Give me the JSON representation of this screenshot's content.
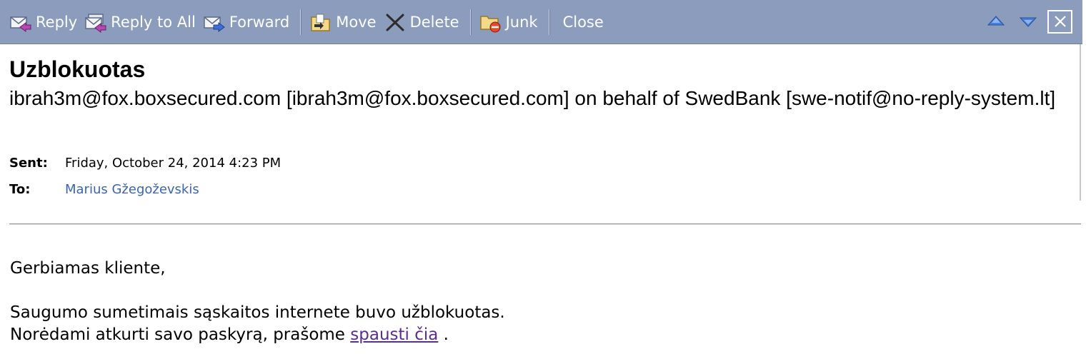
{
  "toolbar": {
    "reply_label": "Reply",
    "reply_all_label": "Reply to All",
    "forward_label": "Forward",
    "move_label": "Move",
    "delete_label": "Delete",
    "junk_label": "Junk",
    "close_label": "Close"
  },
  "message": {
    "subject": "Uzblokuotas",
    "from": "ibrah3m@fox.boxsecured.com [ibrah3m@fox.boxsecured.com] on behalf of SwedBank [swe-notif@no-reply-system.lt]",
    "sent_label": "Sent:",
    "sent_value": "Friday, October 24, 2014 4:23 PM",
    "to_label": "To:",
    "to_value": "Marius Gžegoževskis"
  },
  "body": {
    "greeting": "Gerbiamas kliente,",
    "line1": "Saugumo sumetimais sąskaitos internete buvo užblokuotas.",
    "line2_prefix": "Norėdami atkurti savo paskyrą, prašome ",
    "link_text": "spausti čia",
    "line2_suffix": " ."
  },
  "colors": {
    "toolbar_bg": "#8b9cbd",
    "recipient_link": "#3a63b8",
    "body_link": "#5a2e8e"
  }
}
